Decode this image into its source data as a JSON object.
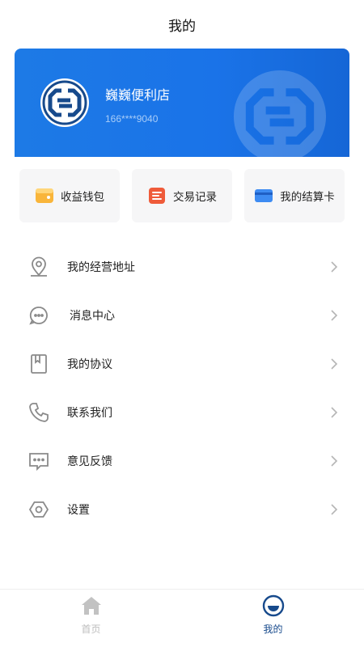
{
  "header": {
    "title": "我的"
  },
  "profile": {
    "store_name": "巍巍便利店",
    "phone": "166****9040"
  },
  "quick_actions": [
    {
      "label": "收益钱包",
      "icon": "wallet-icon"
    },
    {
      "label": "交易记录",
      "icon": "records-icon"
    },
    {
      "label": "我的结算卡",
      "icon": "card-icon"
    }
  ],
  "menu": [
    {
      "label": "我的经营地址",
      "icon": "location-icon"
    },
    {
      "label": "消息中心",
      "icon": "message-icon"
    },
    {
      "label": "我的协议",
      "icon": "agreement-icon"
    },
    {
      "label": "联系我们",
      "icon": "phone-icon"
    },
    {
      "label": "意见反馈",
      "icon": "feedback-icon"
    },
    {
      "label": "设置",
      "icon": "settings-icon"
    }
  ],
  "tabs": [
    {
      "label": "首页",
      "icon": "home-icon",
      "active": false
    },
    {
      "label": "我的",
      "icon": "profile-icon",
      "active": true
    }
  ],
  "colors": {
    "primary": "#1a73e8",
    "tab_active": "#174a8c",
    "tab_inactive": "#bdbdbd",
    "icon_gray": "#8a8a8a"
  }
}
